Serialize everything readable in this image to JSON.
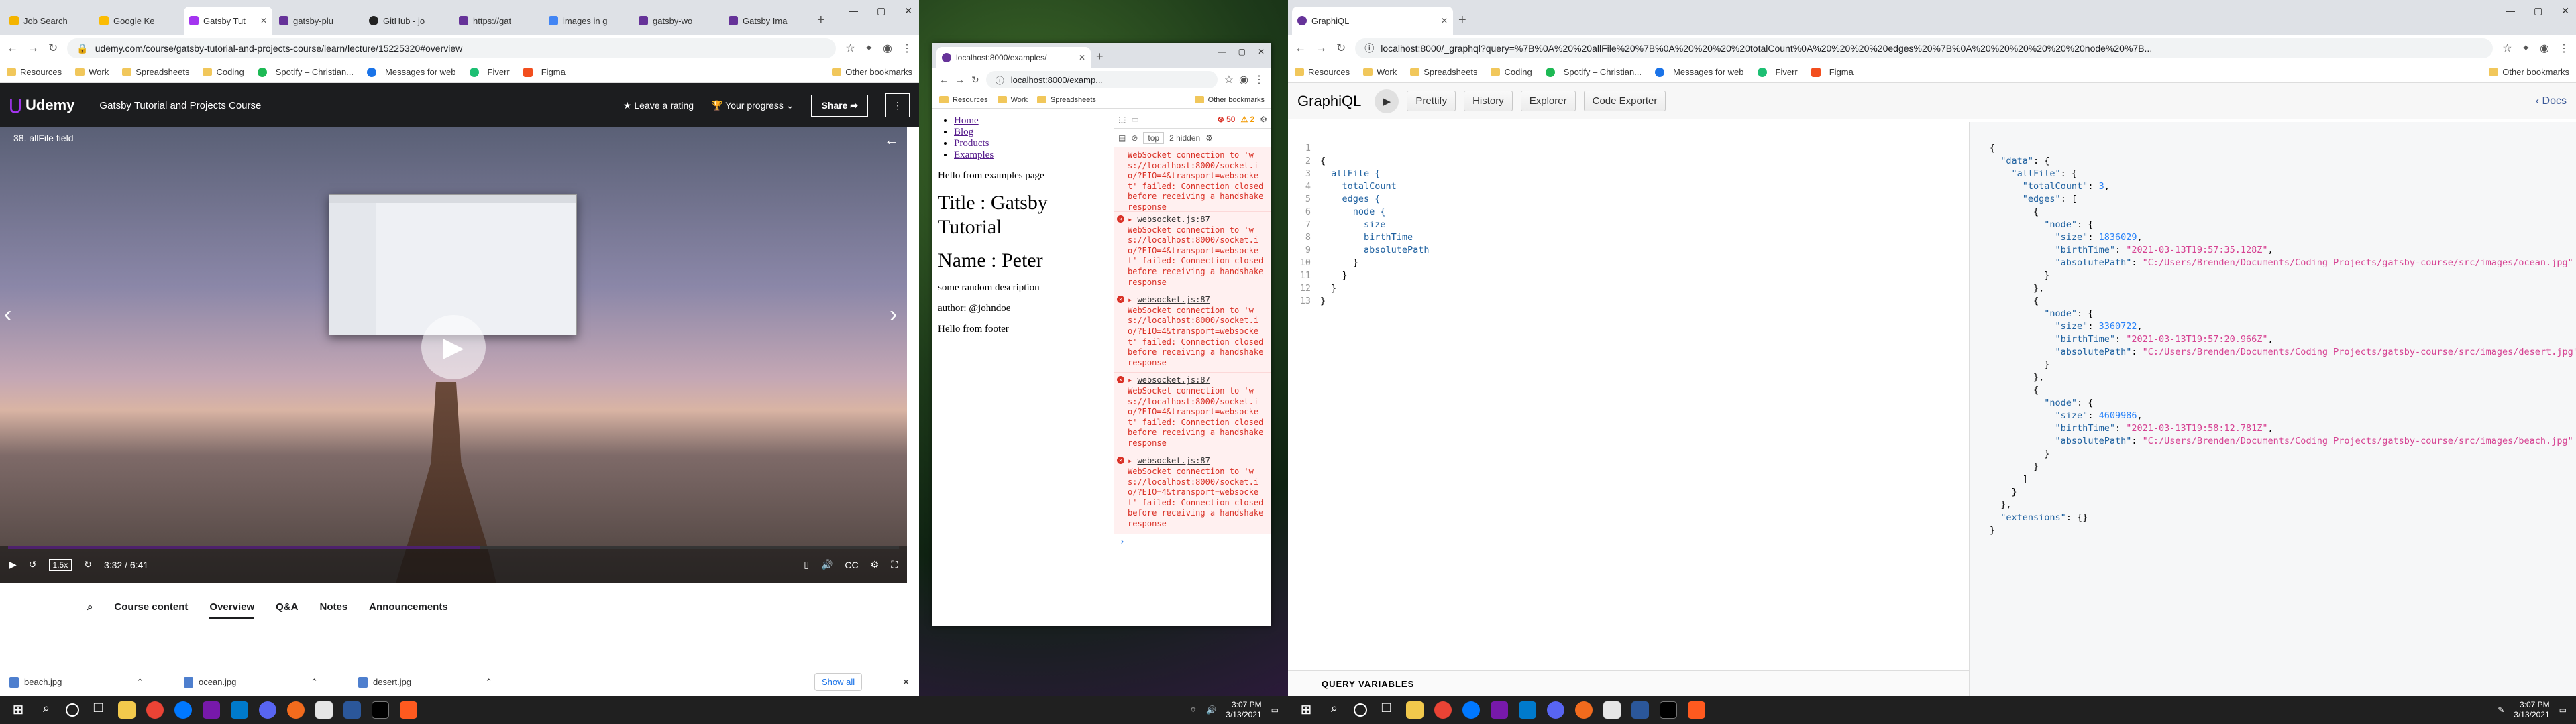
{
  "udemy_window": {
    "tabs": [
      "Job Search",
      "Google Ke",
      "Gatsby Tut",
      "gatsby-plu",
      "GitHub - jo",
      "https://gat",
      "images in g",
      "gatsby-wo",
      "Gatsby Ima"
    ],
    "url": "udemy.com/course/gatsby-tutorial-and-projects-course/learn/lecture/15225320#overview",
    "bookmarks": [
      "Resources",
      "Work",
      "Spreadsheets",
      "Coding",
      "Spotify – Christian...",
      "Messages for web",
      "Fiverr",
      "Figma"
    ],
    "other_bookmarks": "Other bookmarks",
    "brand": "Udemy",
    "course_title": "Gatsby Tutorial and Projects Course",
    "leave_rating": "Leave a rating",
    "your_progress": "Your progress",
    "share": "Share",
    "lecture_title": "38. allFile field",
    "speed": "1.5x",
    "time": "3:32 / 6:41",
    "progress_fraction": 0.53,
    "course_tabs": [
      "Course content",
      "Overview",
      "Q&A",
      "Notes",
      "Announcements"
    ],
    "active_course_tab": "Overview",
    "downloads": [
      "beach.jpg",
      "ocean.jpg",
      "desert.jpg"
    ],
    "show_all": "Show all"
  },
  "localhost_window": {
    "tab": "localhost:8000/examples/",
    "url": "localhost:8000/examp...",
    "bookmarks": [
      "Resources",
      "Work",
      "Spreadsheets",
      "Other bookmarks"
    ],
    "nav": [
      "Home",
      "Blog",
      "Products",
      "Examples"
    ],
    "hello": "Hello from examples page",
    "title_line": "Title : Gatsby Tutorial",
    "name_line": "Name : Peter",
    "description": "some random description",
    "author": "author: @johndoe",
    "footer": "Hello from footer",
    "devtools": {
      "errors": "50",
      "warnings": "2",
      "context": "top",
      "hidden": "2 hidden",
      "partial_message": "WebSocket connection to 'ws://localhost:8000/socket.io/?EIO=4&transport=websocket' failed: Connection closed before receiving a handshake response",
      "source": "websocket.js:87",
      "messages": [
        "WebSocket connection to 'ws://localhost:8000/socket.io/?EIO=4&transport=websocket' failed: Connection closed before receiving a handshake response",
        "WebSocket connection to 'ws://localhost:8000/socket.io/?EIO=4&transport=websocket' failed: Connection closed before receiving a handshake response",
        "WebSocket connection to 'ws://localhost:8000/socket.io/?EIO=4&transport=websocket' failed: Connection closed before receiving a handshake response",
        "WebSocket connection to 'ws://localhost:8000/socket.io/?EIO=4&transport=websocket' failed: Connection closed before receiving a handshake response"
      ]
    },
    "clock_time": "3:07 PM",
    "clock_date": "3/13/2021"
  },
  "graphiql_window": {
    "tab": "GraphiQL",
    "url": "localhost:8000/_graphql?query=%7B%0A%20%20allFile%20%7B%0A%20%20%20%20totalCount%0A%20%20%20%20edges%20%7B%0A%20%20%20%20%20%20node%20%7B...",
    "bookmarks": [
      "Resources",
      "Work",
      "Spreadsheets",
      "Coding",
      "Spotify – Christian...",
      "Messages for web",
      "Fiverr",
      "Figma"
    ],
    "other_bookmarks": "Other bookmarks",
    "title": "GraphiQL",
    "buttons": [
      "Prettify",
      "History",
      "Explorer",
      "Code Exporter"
    ],
    "docs": "Docs",
    "query_lines": [
      "{",
      "  allFile {",
      "    totalCount",
      "    edges {",
      "      node {",
      "        size",
      "        birthTime",
      "        absolutePath",
      "      }",
      "    }",
      "  }",
      "}",
      ""
    ],
    "query_variables": "QUERY VARIABLES",
    "result": {
      "totalCount": "3",
      "nodes": [
        {
          "size": "1836029",
          "birthTime": "\"2021-03-13T19:57:35.128Z\"",
          "absolutePath": "\"C:/Users/Brenden/Documents/Coding Projects/gatsby-course/src/images/ocean.jpg\""
        },
        {
          "size": "3360722",
          "birthTime": "\"2021-03-13T19:57:20.966Z\"",
          "absolutePath": "\"C:/Users/Brenden/Documents/Coding Projects/gatsby-course/src/images/desert.jpg\""
        },
        {
          "size": "4609986",
          "birthTime": "\"2021-03-13T19:58:12.781Z\"",
          "absolutePath": "\"C:/Users/Brenden/Documents/Coding Projects/gatsby-course/src/images/beach.jpg\""
        }
      ],
      "extensions": "{}"
    },
    "clock_time": "3:07 PM",
    "clock_date": "3/13/2021"
  }
}
